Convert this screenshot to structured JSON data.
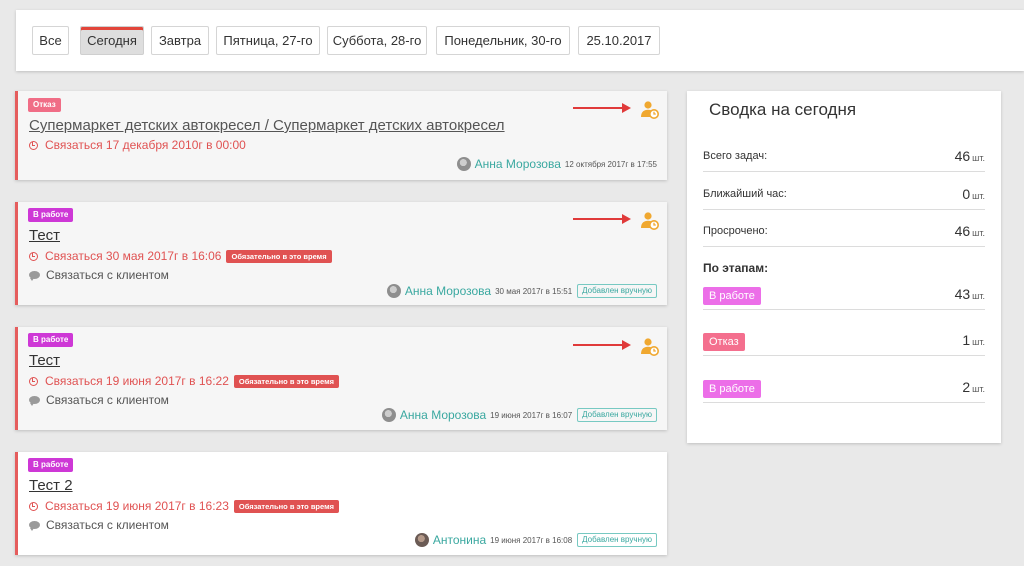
{
  "filters": [
    {
      "label": "Все",
      "active": false
    },
    {
      "label": "Сегодня",
      "active": true
    },
    {
      "label": "Завтра",
      "active": false
    },
    {
      "label": "Пятница, 27-го",
      "active": false
    },
    {
      "label": "Суббота, 28-го",
      "active": false
    },
    {
      "label": "Понедельник, 30-го",
      "active": false
    },
    {
      "label": "25.10.2017",
      "active": false
    }
  ],
  "cards": [
    {
      "status": "Отказ",
      "title": "Супермаркет детских автокресел / Супермаркет детских автокресел",
      "due": "Связаться 17 декабря 2010г в 00:00",
      "author": "Анна Морозова",
      "date": "12 октября 2017г в 17:55"
    },
    {
      "status": "В работе",
      "title": "Тест",
      "due": "Связаться 30 мая 2017г в 16:06",
      "required": "Обязательно в это время",
      "comment": "Связаться с клиентом",
      "author": "Анна Морозова",
      "date": "30 мая 2017г в 15:51",
      "tag": "Добавлен вручную"
    },
    {
      "status": "В работе",
      "title": "Тест",
      "due": "Связаться 19 июня 2017г в 16:22",
      "required": "Обязательно в это время",
      "comment": "Связаться с клиентом",
      "author": "Анна Морозова",
      "date": "19 июня 2017г в 16:07",
      "tag": "Добавлен вручную"
    },
    {
      "status": "В работе",
      "title": "Тест 2",
      "due": "Связаться 19 июня 2017г в 16:23",
      "required": "Обязательно в это время",
      "comment": "Связаться с клиентом",
      "author": "Антонина",
      "date": "19 июня 2017г в 16:08",
      "tag": "Добавлен вручную"
    }
  ],
  "summary": {
    "title": "Сводка на сегодня",
    "unit": "шт.",
    "rows": [
      {
        "label": "Всего задач:",
        "value": "46"
      },
      {
        "label": "Ближайший час:",
        "value": "0"
      },
      {
        "label": "Просрочено:",
        "value": "46"
      }
    ],
    "stages_heading": "По этапам:",
    "stages": [
      {
        "label": "В работе",
        "value": "43"
      },
      {
        "label": "Отказ",
        "value": "1"
      },
      {
        "label": "В работе",
        "value": "2"
      }
    ]
  },
  "colors": {
    "accent_red": "#e05252",
    "teal": "#3aa8a0",
    "badge_refuse": "#f06d86",
    "badge_work": "#ce38d6",
    "icon_orange": "#f0a830"
  },
  "icons": {
    "reschedule": "user-clock-icon",
    "due": "clock-icon",
    "comment": "comment-icon",
    "annotation": "red-arrow"
  }
}
